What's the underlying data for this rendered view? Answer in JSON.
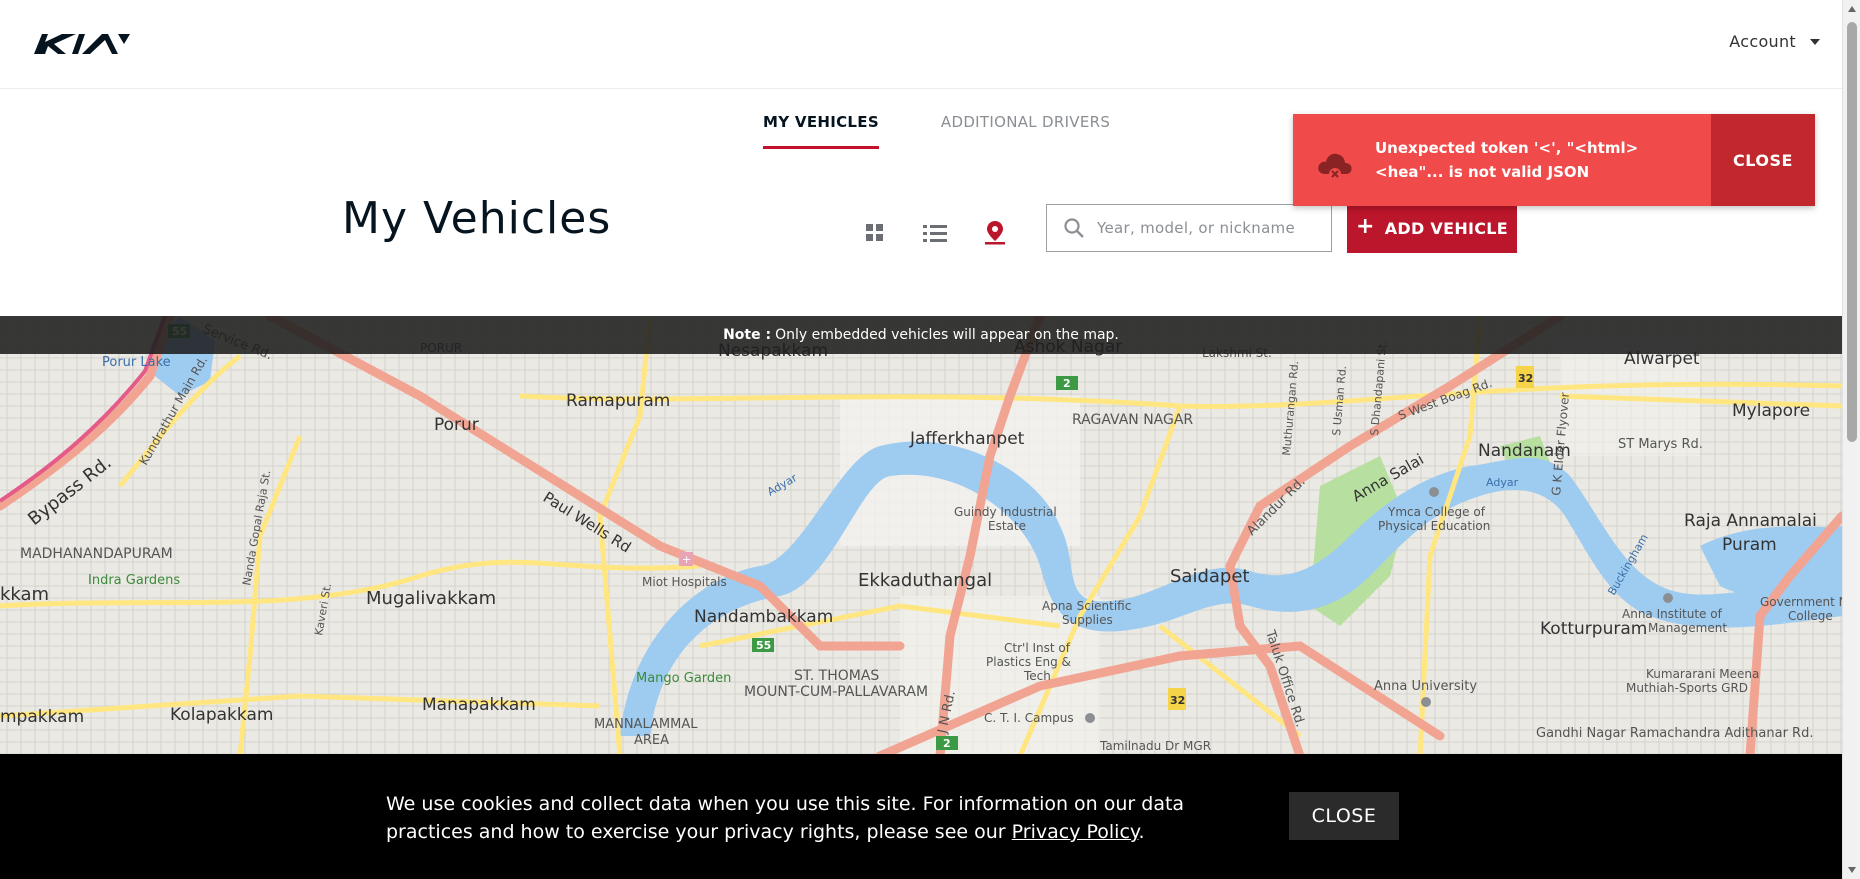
{
  "header": {
    "logo_text": "KIA",
    "account_label": "Account"
  },
  "tabs": [
    {
      "label": "MY VEHICLES",
      "active": true
    },
    {
      "label": "ADDITIONAL DRIVERS",
      "active": false
    }
  ],
  "page": {
    "title": "My Vehicles"
  },
  "view_toggles": [
    {
      "icon": "grid-icon"
    },
    {
      "icon": "list-icon"
    },
    {
      "icon": "map-pin-icon",
      "active": true
    }
  ],
  "search": {
    "placeholder": "Year, model, or nickname",
    "value": ""
  },
  "add_vehicle": {
    "label": "ADD VEHICLE",
    "icon": "plus-icon"
  },
  "toast": {
    "icon": "cloud-error-icon",
    "message": "Unexpected token '<', \"<html><hea\"... is not valid JSON",
    "close_label": "CLOSE"
  },
  "note": {
    "label": "Note :",
    "text": "Only embedded vehicles will appear on the map."
  },
  "map": {
    "places": [
      "Porur Lake",
      "Bypass Rd.",
      "Service Rd.",
      "PORUR",
      "Nesapakkam",
      "Ashok Nagar",
      "Lakshmi St.",
      "Porur",
      "Ramapuram",
      "Jafferkhanpet",
      "RAGAVAN NAGAR",
      "Alwarpet",
      "Mylapore",
      "Kundrathur Main Rd.",
      "Nandanam",
      "ST Marys Rd.",
      "Guindy Industrial Estate",
      "Anna Salai",
      "Ymca College of Physical Education",
      "Raja Annamalai Puram",
      "MADHANANDAPURAM",
      "Paul Wells Rd",
      "Indra Gardens",
      "Miot Hospitals",
      "Ekkaduthangal",
      "Saidapet",
      "Mugalivakkam",
      "Nandambakkam",
      "Apna Scientific Supplies",
      "Kotturpuram",
      "Anna Institute of Management",
      "Mango Garden",
      "ST. THOMAS MOUNT-CUM-PALLAVARAM",
      "Ctr'l Inst of Plastics Eng & Tech",
      "Anna University",
      "Kumararani Meena Muthiah-Sports GRD",
      "Kolapakkam",
      "Manapakkam",
      "MANNALAMMAL AREA",
      "C. T. I. Campus",
      "Tamilnadu Dr MGR",
      "Gandhi Nagar Ramachandra Adithanar Rd.",
      "Alandur Rd.",
      "Taluk Office Rd.",
      "J N Rd.",
      "G K Elder Flyover",
      "Government M College",
      "Adyar",
      "kkam",
      "mpakkam",
      "Kaveri St.",
      "Nanda Gopal Raja St.",
      "Muthurangan Rd.",
      "S Usman Rd.",
      "S Dhandapani St.",
      "S West Boag Rd.",
      "Buckingham"
    ],
    "route_badges": [
      "55",
      "2",
      "55",
      "2",
      "32",
      "32"
    ],
    "colors": {
      "water": "#9ecbf0",
      "park": "#b7dfa0",
      "highway": "#f2a493",
      "road": "#ffe680"
    }
  },
  "cookie": {
    "text_before": "We use cookies and collect data when you use this site. For information on our data practices and how to exercise your privacy rights, please see our",
    "link_text": "Privacy Policy",
    "text_after": ".",
    "close_label": "CLOSE"
  },
  "theme": {
    "accent": "#bb162b",
    "toast_bg": "#f04a4a",
    "toast_close_bg": "#c0282d"
  }
}
